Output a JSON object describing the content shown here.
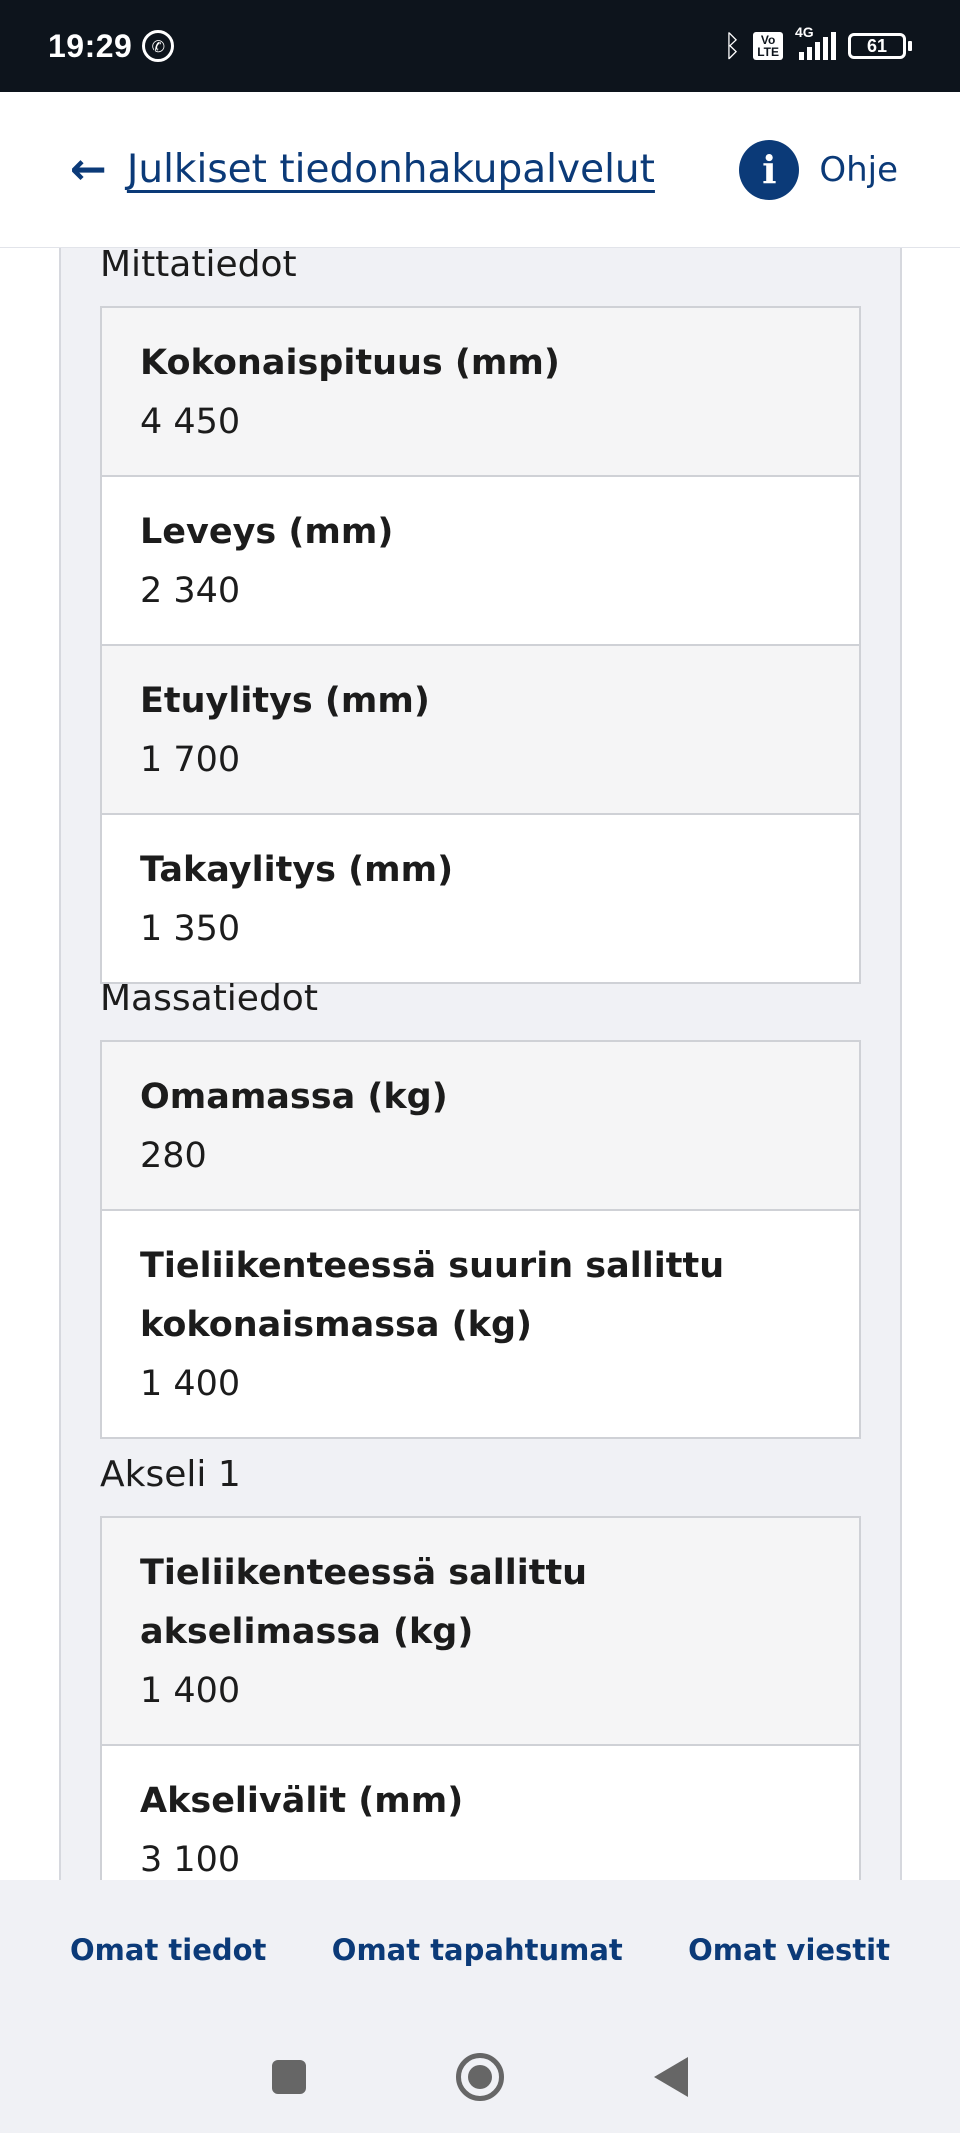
{
  "status_bar": {
    "time": "19:29",
    "network": "4G",
    "volte": "Vo LTE",
    "battery": "61"
  },
  "header": {
    "back_label": "Julkiset tiedonhakupalvelut",
    "help_label": "Ohje"
  },
  "sections": [
    {
      "title": "Mittatiedot",
      "rows": [
        {
          "label": "Kokonaispituus (mm)",
          "value": "4 450"
        },
        {
          "label": "Leveys (mm)",
          "value": "2 340"
        },
        {
          "label": "Etuylitys (mm)",
          "value": "1 700"
        },
        {
          "label": "Takaylitys (mm)",
          "value": "1 350"
        }
      ]
    },
    {
      "title": "Massatiedot",
      "rows": [
        {
          "label": "Omamassa (kg)",
          "value": "280"
        },
        {
          "label": "Tieliikenteessä suurin sallittu kokonaismassa (kg)",
          "value": "1 400"
        }
      ]
    },
    {
      "title": "Akseli 1",
      "rows": [
        {
          "label": "Tieliikenteessä sallittu akselimassa (kg)",
          "value": "1 400"
        },
        {
          "label": "Akselivälit (mm)",
          "value": "3 100"
        }
      ]
    }
  ],
  "bottom_nav": {
    "items": [
      "Omat tiedot",
      "Omat tapahtumat",
      "Omat viestit"
    ]
  },
  "colors": {
    "brand": "#0b3a78",
    "status_bar": "#0d141c"
  },
  "icons": {
    "back": "arrow-left-icon",
    "help": "info-icon"
  }
}
